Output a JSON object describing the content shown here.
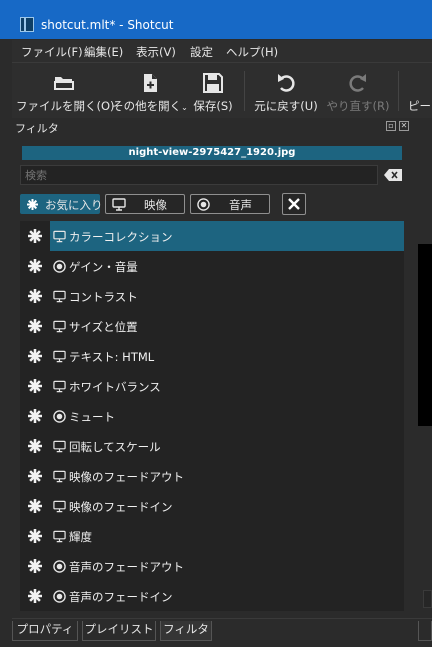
{
  "window": {
    "title": "shotcut.mlt* - Shotcut"
  },
  "menu": [
    "ファイル(F)",
    "編集(E)",
    "表示(V)",
    "設定",
    "ヘルプ(H)"
  ],
  "toolbar": {
    "open_file": "ファイルを開く(O)",
    "open_other": "その他を開く",
    "save": "保存(S)",
    "undo": "元に戻す(U)",
    "redo": "やり直す(R)",
    "peak": "ピー"
  },
  "panel": {
    "title": "フィルタ"
  },
  "clip_name": "night-view-2975427_1920.jpg",
  "search": {
    "placeholder": "検索"
  },
  "categories": {
    "favorites": "お気に入り",
    "video": "映像",
    "audio": "音声"
  },
  "filters": [
    {
      "name": "カラーコレクション",
      "type": "video"
    },
    {
      "name": "ゲイン・音量",
      "type": "audio"
    },
    {
      "name": "コントラスト",
      "type": "video"
    },
    {
      "name": "サイズと位置",
      "type": "video"
    },
    {
      "name": "テキスト: HTML",
      "type": "video"
    },
    {
      "name": "ホワイトバランス",
      "type": "video"
    },
    {
      "name": "ミュート",
      "type": "audio"
    },
    {
      "name": "回転してスケール",
      "type": "video"
    },
    {
      "name": "映像のフェードアウト",
      "type": "video"
    },
    {
      "name": "映像のフェードイン",
      "type": "video"
    },
    {
      "name": "輝度",
      "type": "video"
    },
    {
      "name": "音声のフェードアウト",
      "type": "audio"
    },
    {
      "name": "音声のフェードイン",
      "type": "audio"
    }
  ],
  "tabs": [
    "プロパティ",
    "プレイリスト",
    "フィルタ"
  ],
  "colors": {
    "titlebar": "#1769c6",
    "accent": "#1d6480",
    "background": "#2b2b2b"
  }
}
